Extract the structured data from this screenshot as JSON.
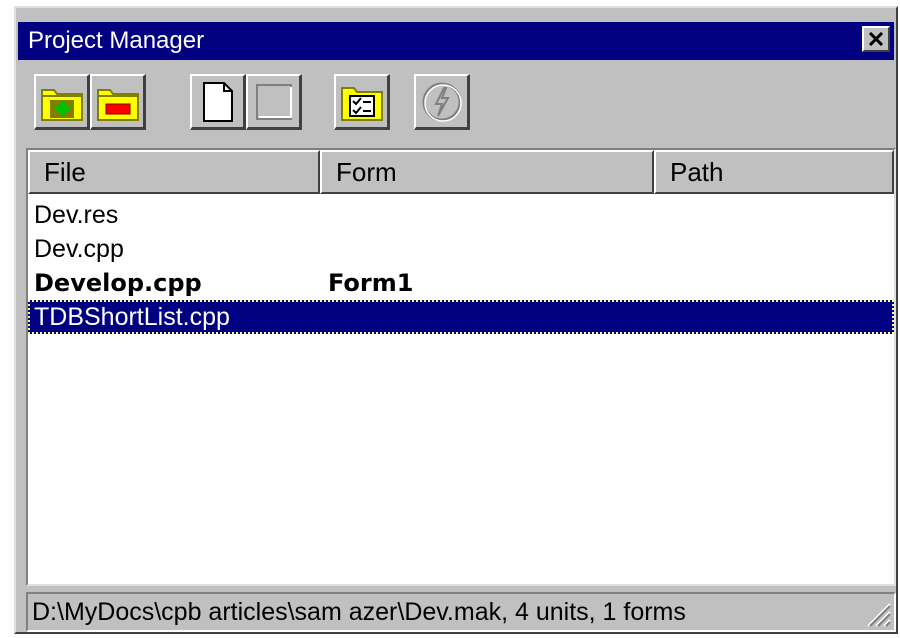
{
  "window": {
    "title": "Project Manager",
    "close_icon": "close-x-icon"
  },
  "toolbar": {
    "buttons": [
      {
        "name": "add-unit-button",
        "icon": "folder-plus-icon",
        "enabled": true
      },
      {
        "name": "remove-unit-button",
        "icon": "folder-minus-icon",
        "enabled": true
      },
      {
        "name": "view-unit-button",
        "icon": "page-icon",
        "enabled": true
      },
      {
        "name": "view-form-button",
        "icon": "form-icon",
        "enabled": false
      },
      {
        "name": "options-button",
        "icon": "checklist-folder-icon",
        "enabled": true
      },
      {
        "name": "update-button",
        "icon": "lightning-icon",
        "enabled": false
      }
    ]
  },
  "list": {
    "columns": [
      "File",
      "Form",
      "Path"
    ],
    "rows": [
      {
        "file": "Dev.res",
        "form": "",
        "path": "",
        "bold": false,
        "selected": false
      },
      {
        "file": "Dev.cpp",
        "form": "",
        "path": "",
        "bold": false,
        "selected": false
      },
      {
        "file": "Develop.cpp",
        "form": "Form1",
        "path": "",
        "bold": true,
        "selected": false
      },
      {
        "file": "TDBShortList.cpp",
        "form": "",
        "path": "",
        "bold": false,
        "selected": true
      }
    ]
  },
  "status": {
    "text": "D:\\MyDocs\\cpb articles\\sam azer\\Dev.mak, 4 units, 1 forms"
  },
  "colors": {
    "titlebar": "#000080",
    "face": "#c0c0c0",
    "selection": "#000080"
  }
}
